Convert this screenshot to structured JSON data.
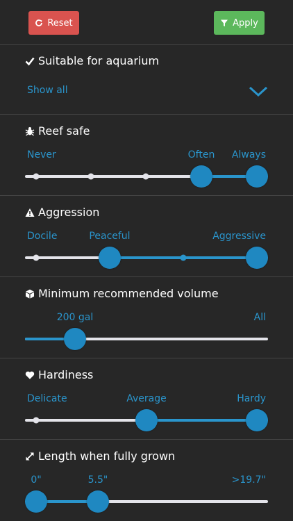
{
  "toolbar": {
    "reset_label": "Reset",
    "apply_label": "Apply"
  },
  "aquarium": {
    "title": "Suitable for aquarium",
    "show_all": "Show all"
  },
  "reef_safe": {
    "title": "Reef safe",
    "labels": {
      "never": "Never",
      "often": "Often",
      "always": "Always"
    },
    "stops": [
      "Never",
      "",
      "",
      "Often",
      "Always"
    ],
    "selected_min": "Often",
    "selected_max": "Always"
  },
  "aggression": {
    "title": "Aggression",
    "labels": {
      "docile": "Docile",
      "peaceful": "Peaceful",
      "aggressive": "Aggressive"
    },
    "stops": [
      "Docile",
      "Peaceful",
      "",
      "Aggressive"
    ],
    "selected_min": "Peaceful",
    "selected_max": "Aggressive"
  },
  "volume": {
    "title": "Minimum recommended volume",
    "labels": {
      "min": "200 gal",
      "max": "All"
    },
    "value_fraction": 0.2
  },
  "hardiness": {
    "title": "Hardiness",
    "labels": {
      "delicate": "Delicate",
      "average": "Average",
      "hardy": "Hardy"
    },
    "stops": [
      "Delicate",
      "Average",
      "Hardy"
    ],
    "selected_min": "Average",
    "selected_max": "Hardy"
  },
  "length": {
    "title": "Length when fully grown",
    "labels": {
      "min": "0\"",
      "mid": "5.5\"",
      "max": ">19.7\""
    },
    "selected_min": "0\"",
    "selected_max": "5.5\""
  },
  "colors": {
    "accent": "#2a95cc",
    "knob": "#1f88c1",
    "track": "#e4e4ea",
    "reset": "#d9534f",
    "apply": "#5cb85c",
    "background": "#272727"
  }
}
